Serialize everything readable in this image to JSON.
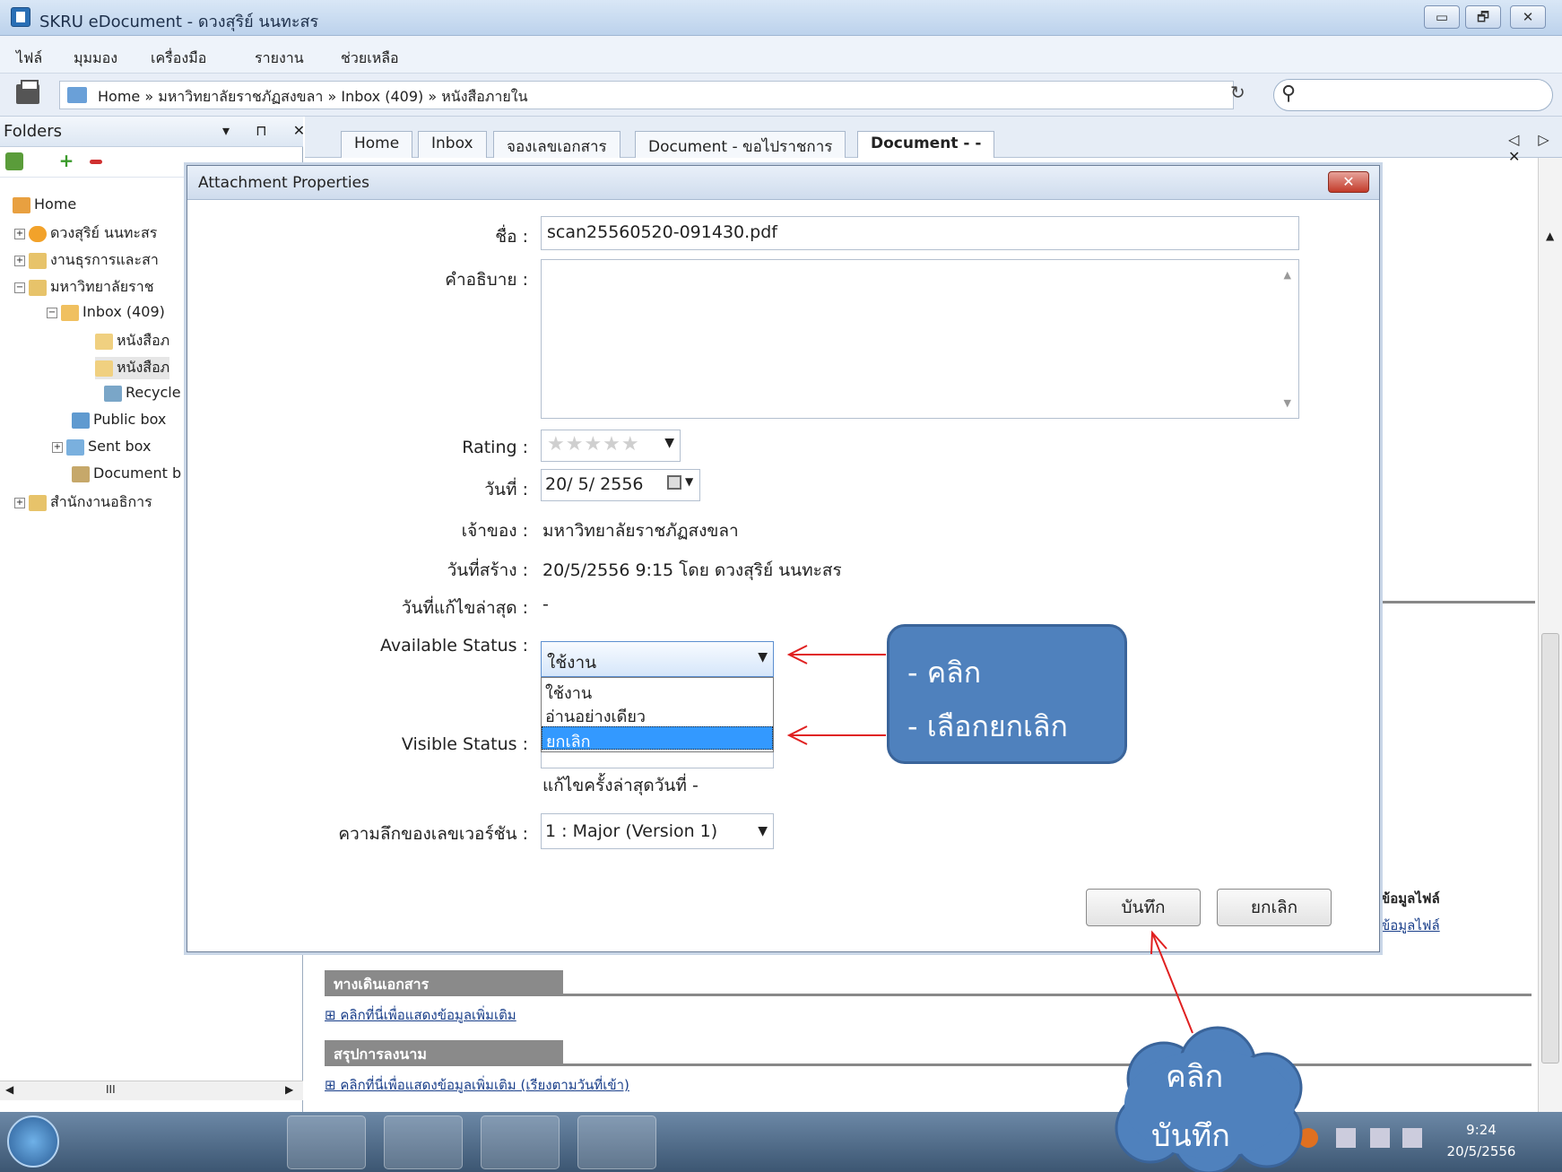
{
  "window": {
    "title": "SKRU eDocument - ดวงสุริย์ นนทะสร",
    "min": "▭",
    "max": "🗗",
    "close": "✕"
  },
  "menu": [
    "ไฟล์",
    "มุมมอง",
    "เครื่องมือ",
    "รายงาน",
    "ช่วยเหลือ"
  ],
  "address": {
    "breadcrumb": "Home » มหาวิทยาลัยราชภัฏสงขลา » Inbox (409) » หนังสือภายใน",
    "refresh": "↻",
    "search_icon": "⚲"
  },
  "folders": {
    "title": "Folders",
    "controls": "▾ ⊓ ✕",
    "tree": [
      {
        "label": "Home",
        "icon": "home-icon"
      },
      {
        "label": "ดวงสุริย์ นนทะสร",
        "icon": "user-icon"
      },
      {
        "label": "งานธุรการและสา",
        "icon": "folder-icon"
      },
      {
        "label": "มหาวิทยาลัยราช",
        "icon": "folder-icon"
      },
      {
        "label": "Inbox (409)",
        "icon": "inbox-icon"
      },
      {
        "label": "หนังสือภ",
        "icon": "doc-folder-icon"
      },
      {
        "label": "หนังสือภ",
        "icon": "doc-folder-icon"
      },
      {
        "label": "Recycle",
        "icon": "recycle-icon"
      },
      {
        "label": "Public box",
        "icon": "public-box-icon"
      },
      {
        "label": "Sent box",
        "icon": "sent-box-icon"
      },
      {
        "label": "Document b",
        "icon": "document-box-icon"
      },
      {
        "label": "สำนักงานอธิการ",
        "icon": "folder-icon"
      }
    ],
    "scroll_mid": "III"
  },
  "tabs": [
    "Home",
    "Inbox",
    "จองเลขเอกสาร",
    "Document - ขอไปราชการ",
    "Document - -"
  ],
  "tab_nav": "◁ ▷ ✕",
  "background": {
    "section1": "ทางเดินเอกสาร",
    "link1": "⊞ คลิกที่นี่เพื่อแสดงข้อมูลเพิ่มเติม",
    "section2": "สรุปการลงนาม",
    "link2": "⊞ คลิกที่นี่เพื่อแสดงข้อมูลเพิ่มเติม (เรียงตามวันที่เข้า)",
    "side1": "ข้อมูลไฟล์",
    "side2": "ข้อมูลไฟล์"
  },
  "dialog": {
    "title": "Attachment Properties",
    "close": "✕",
    "name_label": "ชื่อ :",
    "name_value": "scan25560520-091430.pdf",
    "desc_label": "คำอธิบาย :",
    "desc_value": "",
    "rating_label": "Rating :",
    "rating_value": "★★★★★",
    "rating_stars": 0,
    "date_label": "วันที่ :",
    "date_value": "20/ 5/ 2556",
    "owner_label": "เจ้าของ :",
    "owner_value": "มหาวิทยาลัยราชภัฏสงขลา",
    "created_label": "วันที่สร้าง :",
    "created_value": "20/5/2556 9:15 โดย ดวงสุริย์ นนทะสร",
    "modified_label": "วันที่แก้ไขล่าสุด :",
    "modified_value": "-",
    "available_label": "Available Status :",
    "available_value": "ใช้งาน",
    "available_options": [
      "ใช้งาน",
      "อ่านอย่างเดียว",
      "ยกเลิก"
    ],
    "visible_label": "Visible Status :",
    "visible_note": "แก้ไขครั้งล่าสุดวันที่ -",
    "version_label": "ความลึกของเลขเวอร์ชัน :",
    "version_value": "1 : Major (Version 1)",
    "save": "บันทึก",
    "cancel": "ยกเลิก"
  },
  "annotations": {
    "callout_line1": "- คลิก",
    "callout_line2": "- เลือกยกเลิก",
    "cloud_line1": "คลิก",
    "cloud_line2": "บันทึก",
    "accent": "#4f81bd",
    "arrow": "#e02020"
  },
  "taskbar": {
    "time": "9:24",
    "date": "20/5/2556"
  }
}
